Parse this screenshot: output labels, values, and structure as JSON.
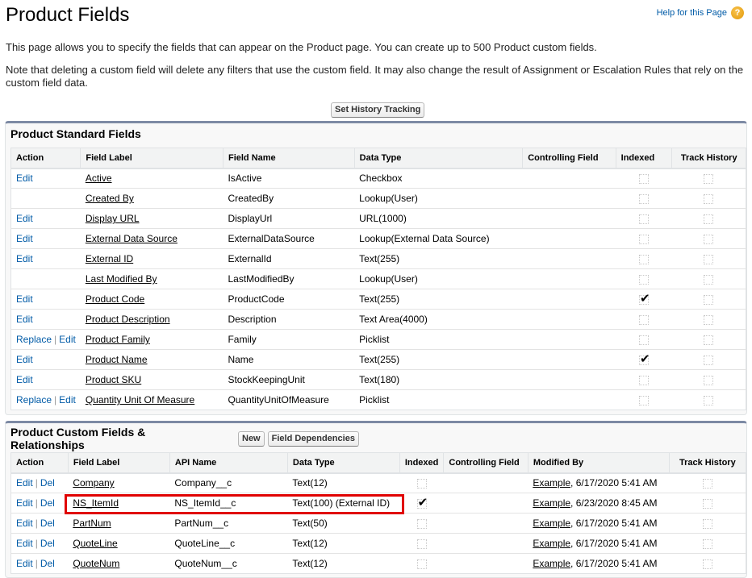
{
  "header": {
    "title": "Product Fields",
    "help_link": "Help for this Page",
    "help_icon": "question-mark-icon"
  },
  "intro": {
    "line1": "This page allows you to specify the fields that can appear on the Product page. You can create up to 500 Product custom fields.",
    "line2": "Note that deleting a custom field will delete any filters that use the custom field. It may also change the result of Assignment or Escalation Rules that rely on the custom field data."
  },
  "toolbar": {
    "set_history_label": "Set History Tracking"
  },
  "standard": {
    "title": "Product Standard Fields",
    "columns": [
      "Action",
      "Field Label",
      "Field Name",
      "Data Type",
      "Controlling Field",
      "Indexed",
      "Track History"
    ],
    "rows": [
      {
        "actions": [
          "Edit"
        ],
        "label": "Active",
        "name": "IsActive",
        "type": "Checkbox",
        "controlling": "",
        "indexed": false,
        "track": false
      },
      {
        "actions": [],
        "label": "Created By",
        "name": "CreatedBy",
        "type": "Lookup(User)",
        "controlling": "",
        "indexed": false,
        "track": false
      },
      {
        "actions": [
          "Edit"
        ],
        "label": "Display URL",
        "name": "DisplayUrl",
        "type": "URL(1000)",
        "controlling": "",
        "indexed": false,
        "track": false
      },
      {
        "actions": [
          "Edit"
        ],
        "label": "External Data Source",
        "name": "ExternalDataSource",
        "type": "Lookup(External Data Source)",
        "controlling": "",
        "indexed": false,
        "track": false
      },
      {
        "actions": [
          "Edit"
        ],
        "label": "External ID",
        "name": "ExternalId",
        "type": "Text(255)",
        "controlling": "",
        "indexed": false,
        "track": false
      },
      {
        "actions": [],
        "label": "Last Modified By",
        "name": "LastModifiedBy",
        "type": "Lookup(User)",
        "controlling": "",
        "indexed": false,
        "track": false
      },
      {
        "actions": [
          "Edit"
        ],
        "label": "Product Code",
        "name": "ProductCode",
        "type": "Text(255)",
        "controlling": "",
        "indexed": true,
        "track": false
      },
      {
        "actions": [
          "Edit"
        ],
        "label": "Product Description",
        "name": "Description",
        "type": "Text Area(4000)",
        "controlling": "",
        "indexed": false,
        "track": false
      },
      {
        "actions": [
          "Replace",
          "Edit"
        ],
        "label": "Product Family",
        "name": "Family",
        "type": "Picklist",
        "controlling": "",
        "indexed": false,
        "track": false
      },
      {
        "actions": [
          "Edit"
        ],
        "label": "Product Name",
        "name": "Name",
        "type": "Text(255)",
        "controlling": "",
        "indexed": true,
        "track": false
      },
      {
        "actions": [
          "Edit"
        ],
        "label": "Product SKU",
        "name": "StockKeepingUnit",
        "type": "Text(180)",
        "controlling": "",
        "indexed": false,
        "track": false
      },
      {
        "actions": [
          "Replace",
          "Edit"
        ],
        "label": "Quantity Unit Of Measure",
        "name": "QuantityUnitOfMeasure",
        "type": "Picklist",
        "controlling": "",
        "indexed": false,
        "track": false
      }
    ]
  },
  "custom": {
    "title": "Product Custom Fields & Relationships",
    "new_label": "New",
    "deps_label": "Field Dependencies",
    "columns": [
      "Action",
      "Field Label",
      "API Name",
      "Data Type",
      "Indexed",
      "Controlling Field",
      "Modified By",
      "Track History"
    ],
    "rows": [
      {
        "actions": [
          "Edit",
          "Del"
        ],
        "label": "Company",
        "api": "Company__c",
        "type": "Text(12)",
        "indexed": false,
        "controlling": "",
        "modified_user": "Example",
        "modified_date": ", 6/17/2020 5:41 AM",
        "track": false
      },
      {
        "actions": [
          "Edit",
          "Del"
        ],
        "label": "NS_ItemId",
        "api": "NS_ItemId__c",
        "type": "Text(100) (External ID)",
        "indexed": true,
        "controlling": "",
        "modified_user": "Example",
        "modified_date": ", 6/23/2020 8:45 AM",
        "track": false,
        "highlighted": true
      },
      {
        "actions": [
          "Edit",
          "Del"
        ],
        "label": "PartNum",
        "api": "PartNum__c",
        "type": "Text(50)",
        "indexed": false,
        "controlling": "",
        "modified_user": "Example",
        "modified_date": ", 6/17/2020 5:41 AM",
        "track": false
      },
      {
        "actions": [
          "Edit",
          "Del"
        ],
        "label": "QuoteLine",
        "api": "QuoteLine__c",
        "type": "Text(12)",
        "indexed": false,
        "controlling": "",
        "modified_user": "Example",
        "modified_date": ", 6/17/2020 5:41 AM",
        "track": false
      },
      {
        "actions": [
          "Edit",
          "Del"
        ],
        "label": "QuoteNum",
        "api": "QuoteNum__c",
        "type": "Text(12)",
        "indexed": false,
        "controlling": "",
        "modified_user": "Example",
        "modified_date": ", 6/17/2020 5:41 AM",
        "track": false
      }
    ]
  },
  "colors": {
    "link": "#015ba7",
    "block_border": "#7d8aa4",
    "highlight": "#e00000"
  }
}
